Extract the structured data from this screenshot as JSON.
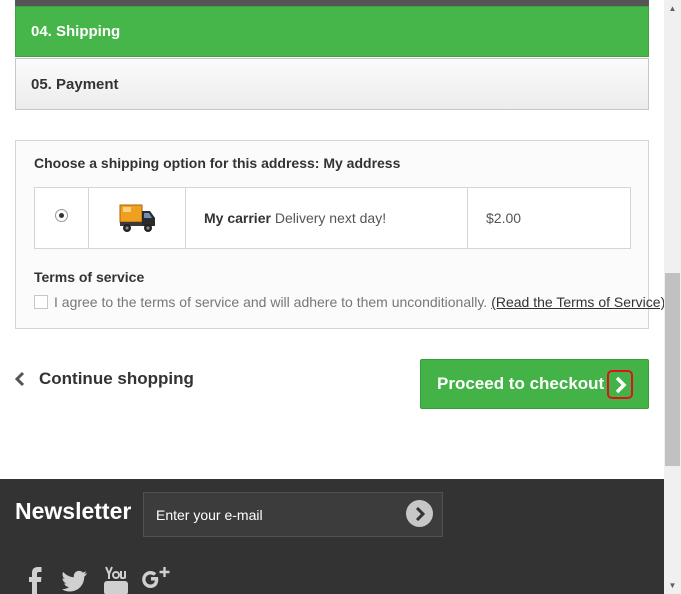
{
  "steps": {
    "shipping_label": "04. Shipping",
    "payment_label": "05. Payment"
  },
  "shipping": {
    "title": "Choose a shipping option for this address: My address",
    "carrier_name": "My carrier",
    "carrier_delay": "Delivery next day!",
    "price": "$2.00",
    "selected": true
  },
  "terms": {
    "title": "Terms of service",
    "agree_text": "I agree to the terms of service and will adhere to them unconditionally.",
    "link_text": "(Read the Terms of Service)",
    "checked": false
  },
  "actions": {
    "continue_label": "Continue shopping",
    "checkout_label": "Proceed to checkout"
  },
  "footer": {
    "newsletter_title": "Newsletter",
    "email_placeholder": "Enter your e-mail",
    "social_icons": [
      "facebook-icon",
      "twitter-icon",
      "youtube-icon",
      "google-plus-icon"
    ]
  },
  "colors": {
    "active_step": "#46b64a",
    "checkout_button": "#43b347",
    "focus_outline": "#e01020",
    "footer_bg": "#333333"
  }
}
